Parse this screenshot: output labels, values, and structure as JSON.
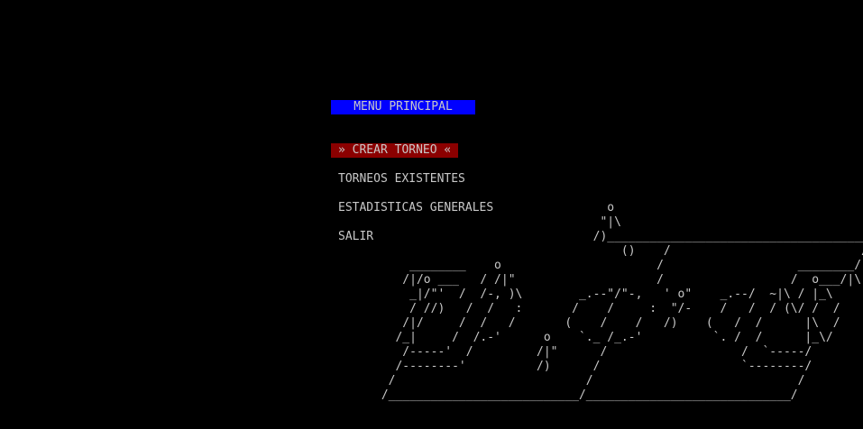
{
  "colors": {
    "background": "#000000",
    "text": "#c8c8c8",
    "title_bg": "#0000ff",
    "selected_bg": "#8b0000"
  },
  "menu": {
    "title": "MENU PRINCIPAL",
    "items": [
      {
        "label": "» CREAR TORNEO «",
        "selected": true
      },
      {
        "label": "TORNEOS EXISTENTES",
        "selected": false
      },
      {
        "label": "ESTADISTICAS GENERALES",
        "selected": false
      },
      {
        "label": "SALIR",
        "selected": false
      }
    ]
  },
  "ascii_art": "                                 o\n                                \"|\\\n                               /)______________________________________\n                                   ()    /                           /\n     ________    o                      /                   ________/\n    /|/o ___   / /|\"                    /                  /  o___/|\\\n     _|/\"'  /  /-, )\\        _.--\"/\"-,   ' o\"    _.--/  ~|\\ / |_\\\n     / //)   /  /   :       /    /     :  \"/-    /   /  / (\\/ /  /\n    /|/     /  /   /       (    /    /   /)    (   /  /      |\\  /\n   /_|     /  /.-'      o    `._ /_.-'          `. /  /      |_\\/\n    /-----'  /         /|\"      /                   /  `-----/\n   /--------'          /)      /                    `--------/\n  /                           /                             /\n /___________________________/_____________________________/"
}
